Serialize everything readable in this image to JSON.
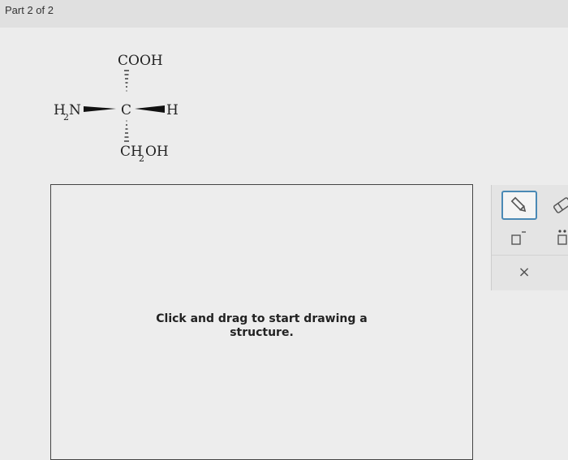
{
  "header": {
    "part_label": "Part 2 of 2"
  },
  "molecule": {
    "top": "COOH",
    "left_main": "H",
    "left_sub": "2",
    "left_end": "N",
    "center": "C",
    "right": "H",
    "bottom_main": "CH",
    "bottom_sub": "2",
    "bottom_end": "OH"
  },
  "canvas": {
    "hint_line1": "Click and drag to start drawing a",
    "hint_line2": "structure."
  },
  "toolbar": {
    "tools": [
      "pencil-icon",
      "eraser-icon",
      "charge-icon",
      "lone-pair-icon",
      "close-icon"
    ],
    "clear_label": "×"
  },
  "colors": {
    "accent": "#4a89b5",
    "background": "#ececec"
  }
}
